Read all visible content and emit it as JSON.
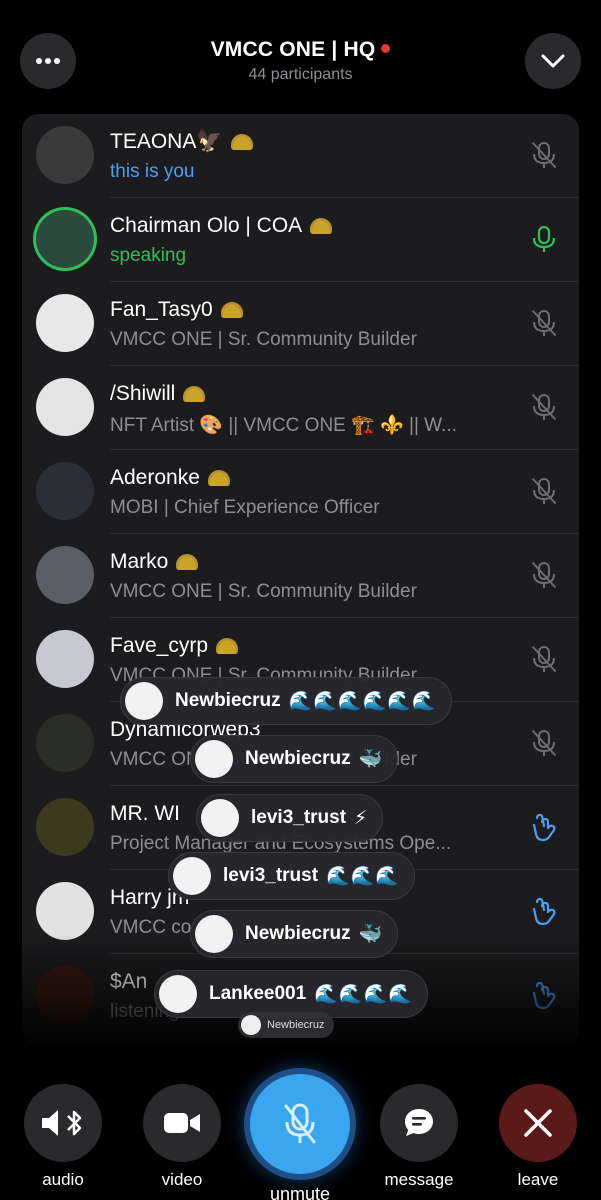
{
  "header": {
    "title": "VMCC ONE | HQ",
    "participants": "44 participants"
  },
  "participants": [
    {
      "name": "TEAONA🦅",
      "sub": "this is you",
      "status": "you",
      "mic": "muted"
    },
    {
      "name": "Chairman Olo | COA",
      "sub": "speaking",
      "status": "speaking",
      "mic": "active"
    },
    {
      "name": "Fan_Tasy0",
      "sub": "VMCC ONE | Sr. Community Builder",
      "status": "normal",
      "mic": "muted"
    },
    {
      "name": "/Shiwill",
      "sub": "NFT Artist 🎨 || VMCC ONE 🏗️ ⚜️ || W...",
      "status": "normal",
      "mic": "muted"
    },
    {
      "name": "Aderonke",
      "sub": "MOBI | Chief Experience Officer",
      "status": "normal",
      "mic": "muted"
    },
    {
      "name": "Marko",
      "sub": "VMCC ONE | Sr. Community Builder",
      "status": "normal",
      "mic": "muted"
    },
    {
      "name": "Fave_cyrp",
      "sub": "VMCC ONE | Sr. Community Builder",
      "status": "normal",
      "mic": "muted"
    },
    {
      "name": "Dynamicorwep3",
      "sub": "VMCC ONE | Sr. Community Builder",
      "status": "normal",
      "mic": "muted"
    },
    {
      "name": "MR. WI",
      "sub": "Project Manager and Ecosystems Ope...",
      "status": "normal",
      "mic": "hand"
    },
    {
      "name": "Harry jm",
      "sub": "VMCC co",
      "status": "normal",
      "mic": "hand"
    },
    {
      "name": "$An",
      "sub": "listening",
      "status": "normal",
      "mic": "hand"
    }
  ],
  "reactions": [
    {
      "name": "Newbiecruz",
      "emoji": "🌊🌊🌊🌊🌊🌊"
    },
    {
      "name": "Newbiecruz",
      "emoji": "🐳"
    },
    {
      "name": "levi3_trust",
      "emoji": "⚡"
    },
    {
      "name": "levi3_trust",
      "emoji": "🌊🌊🌊"
    },
    {
      "name": "Newbiecruz",
      "emoji": "🐳"
    },
    {
      "name": "Lankee001",
      "emoji": "🌊🌊🌊🌊"
    }
  ],
  "mini_reaction": {
    "name": "Newbiecruz"
  },
  "controls": {
    "audio": "audio",
    "video": "video",
    "unmute": "unmute",
    "message": "message",
    "leave": "leave"
  },
  "colors": {
    "accent": "#3aa6f0",
    "speaking": "#2fbf5a",
    "you": "#4a9ff5",
    "live_dot": "#e53935",
    "leave": "#5b1a1a"
  }
}
